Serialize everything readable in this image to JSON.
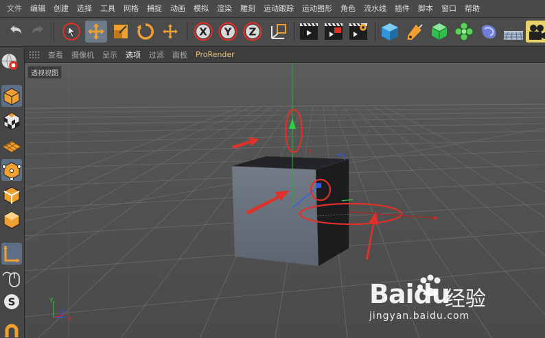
{
  "menu": {
    "items": [
      "文件",
      "编辑",
      "创建",
      "选择",
      "工具",
      "网格",
      "捕捉",
      "动画",
      "模拟",
      "渲染",
      "雕刻",
      "运动跟踪",
      "运动图形",
      "角色",
      "流水线",
      "插件",
      "脚本",
      "窗口",
      "帮助"
    ]
  },
  "toolbar": {
    "icons": [
      "undo-icon",
      "redo-icon",
      "live-select-icon",
      "move-icon",
      "scale-icon",
      "rotate-icon",
      "recent-tool-icon",
      "x-axis-lock-icon",
      "y-axis-lock-icon",
      "z-axis-lock-icon",
      "coordinate-system-icon",
      "render-view-icon",
      "render-to-picture-viewer-icon",
      "render-settings-icon",
      "cube-icon",
      "pen-icon",
      "subdivision-icon",
      "cloner-icon",
      "deformer-icon",
      "floor-icon",
      "camera-icon"
    ],
    "axis_labels": {
      "x": "X",
      "y": "Y",
      "z": "Z"
    }
  },
  "viewport": {
    "menu": [
      "查看",
      "摄像机",
      "显示",
      "选项",
      "过滤",
      "面板",
      "ProRender"
    ],
    "selected_menu": "选项",
    "label": "透视视图",
    "axis_labels": {
      "y": "Y",
      "z": "Z",
      "x": "X"
    }
  },
  "watermark": {
    "brand": "Baidu",
    "cn": "经验",
    "url": "jingyan.baidu.com"
  },
  "colors": {
    "accent_orange": "#f0a030",
    "annotation_red": "#e0302a",
    "axis_green": "#2fd03c",
    "axis_blue": "#2c58ff",
    "axis_red": "#d42a2a"
  }
}
